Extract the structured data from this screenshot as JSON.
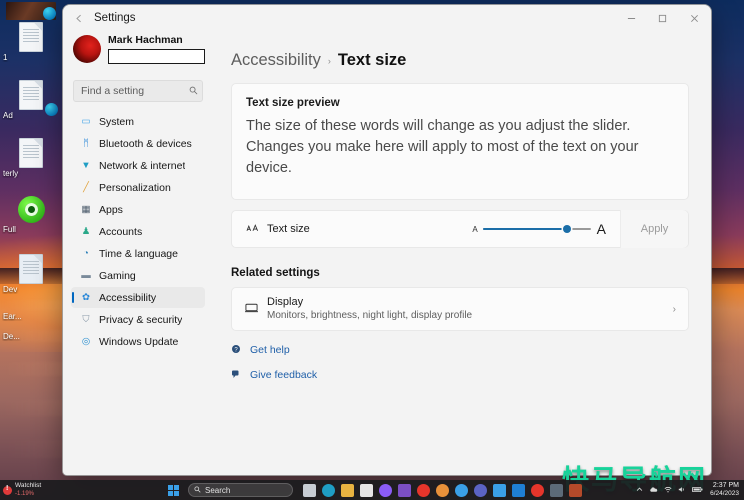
{
  "window": {
    "title": "Settings",
    "back_icon": "back-arrow-icon",
    "minimize_icon": "—",
    "maximize_icon": "☐",
    "close_icon": "✕"
  },
  "sidebar": {
    "user_name": "Mark Hachman",
    "user_email": "",
    "search": {
      "placeholder": "Find a setting",
      "value": "",
      "icon": "search-icon"
    },
    "items": [
      {
        "label": "System",
        "icon": "▭",
        "color": "#3aa0e8",
        "active": false
      },
      {
        "label": "Bluetooth & devices",
        "icon": "ᛗ",
        "color": "#2b88d8",
        "active": false
      },
      {
        "label": "Network & internet",
        "icon": "▼",
        "color": "#1f9ec4",
        "active": false
      },
      {
        "label": "Personalization",
        "icon": "╱",
        "color": "#e0a23c",
        "active": false
      },
      {
        "label": "Apps",
        "icon": "▦",
        "color": "#4a5a6a",
        "active": false
      },
      {
        "label": "Accounts",
        "icon": "♟",
        "color": "#2aa889",
        "active": false
      },
      {
        "label": "Time & language",
        "icon": "◔",
        "color": "#2a7fb8",
        "active": false
      },
      {
        "label": "Gaming",
        "icon": "▬",
        "color": "#7a8a9a",
        "active": false
      },
      {
        "label": "Accessibility",
        "icon": "✿",
        "color": "#2b88d8",
        "active": true
      },
      {
        "label": "Privacy & security",
        "icon": "⛉",
        "color": "#8a9aa8",
        "active": false
      },
      {
        "label": "Windows Update",
        "icon": "◎",
        "color": "#2a8fd0",
        "active": false
      }
    ]
  },
  "main": {
    "breadcrumb": {
      "parent": "Accessibility",
      "separator": "›",
      "current": "Text size"
    },
    "preview": {
      "title": "Text size preview",
      "body": "The size of these words will change as you adjust the slider. Changes you make here will apply to most of the text on your device."
    },
    "slider_row": {
      "icon": "text-size-icon",
      "label": "Text size",
      "small_a": "A",
      "large_a": "A",
      "value_percent": 78,
      "apply_label": "Apply"
    },
    "related": {
      "title": "Related settings",
      "display": {
        "icon": "monitor-icon",
        "title": "Display",
        "subtitle": "Monitors, brightness, night light, display profile",
        "chevron": "›"
      }
    },
    "links": [
      {
        "label": "Get help",
        "icon": "help-icon"
      },
      {
        "label": "Give feedback",
        "icon": "feedback-icon"
      }
    ]
  },
  "desktop": {
    "icons": [
      {
        "label": "1",
        "type": "doc"
      },
      {
        "label": "Ad",
        "type": "doc-edge"
      },
      {
        "label": "terly",
        "type": "doc"
      },
      {
        "label": "Full",
        "type": "green"
      },
      {
        "label": "Dev",
        "type": "doc"
      },
      {
        "label": "Ear...",
        "type": "text"
      },
      {
        "label": "De...",
        "type": "text"
      }
    ]
  },
  "watermark": "快马导航网",
  "taskbar": {
    "watchlist": {
      "name": "Watchlist",
      "value": "-1.19%"
    },
    "start_label": "start-button",
    "search": {
      "label": "Search",
      "icon": "search-icon"
    },
    "apps": [
      {
        "name": "task-view",
        "color": "#c8cdd4"
      },
      {
        "name": "edge-browser",
        "color": "#1f9ec4"
      },
      {
        "name": "file-explorer",
        "color": "#e8b341"
      },
      {
        "name": "microsoft-store",
        "color": "#e6e6e6"
      },
      {
        "name": "photos",
        "color": "#8b5cf6"
      },
      {
        "name": "app-purple",
        "color": "#7b4fc4"
      },
      {
        "name": "opera-browser",
        "color": "#e6352b"
      },
      {
        "name": "firefox-browser",
        "color": "#e8913a"
      },
      {
        "name": "chrome-browser",
        "color": "#3aa0e8"
      },
      {
        "name": "teams",
        "color": "#5b63c4"
      },
      {
        "name": "notepad",
        "color": "#3aa0e8"
      },
      {
        "name": "mail",
        "color": "#1f7fd4"
      },
      {
        "name": "vivaldi-browser",
        "color": "#e6352b"
      },
      {
        "name": "settings",
        "color": "#5c6a78"
      },
      {
        "name": "app-extra",
        "color": "#b44a2a"
      }
    ],
    "tray": [
      {
        "name": "show-hidden-icons",
        "glyph": "⌃"
      },
      {
        "name": "onedrive-icon",
        "glyph": "☁"
      },
      {
        "name": "wifi-icon",
        "glyph": "◆"
      },
      {
        "name": "volume-icon",
        "glyph": "◑"
      },
      {
        "name": "battery-icon",
        "glyph": "▬"
      }
    ],
    "clock": {
      "time": "2:37 PM",
      "date": "6/24/2023"
    }
  }
}
